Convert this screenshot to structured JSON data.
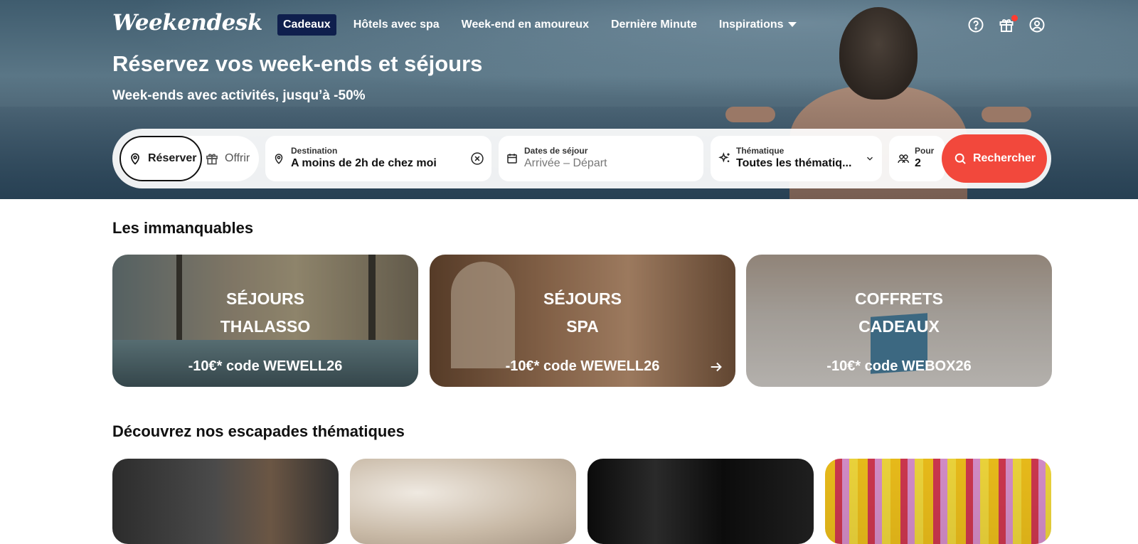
{
  "brand": {
    "logo_text": "Weekendesk"
  },
  "nav": {
    "items": [
      {
        "label": "Cadeaux",
        "active": true
      },
      {
        "label": "Hôtels avec spa"
      },
      {
        "label": "Week-end en amoureux"
      },
      {
        "label": "Dernière Minute"
      },
      {
        "label": "Inspirations"
      }
    ]
  },
  "top_icons": [
    "help-icon",
    "gift-icon",
    "account-icon"
  ],
  "hero": {
    "title": "Réservez vos week-ends et séjours",
    "subtitle": "Week-ends avec activités, jusqu’à -50%"
  },
  "search": {
    "mode_reserve": "Réserver",
    "mode_offer": "Offrir",
    "destination_label": "Destination",
    "destination_value": "A moins de 2h de chez moi",
    "dates_label": "Dates de séjour",
    "dates_placeholder": "Arrivée – Départ",
    "theme_label": "Thématique",
    "theme_value": "Toutes les thématiq...",
    "pour_label": "Pour",
    "pour_value": "2",
    "button_label": "Rechercher",
    "accent_color": "#f2483c"
  },
  "sections": {
    "immanquables_title": "Les immanquables",
    "escapades_title": "Découvrez nos escapades thématiques"
  },
  "cards": [
    {
      "line1": "SÉJOURS",
      "line2": "THALASSO",
      "promo": "-10€* code WEWELL26"
    },
    {
      "line1": "SÉJOURS",
      "line2": "SPA",
      "promo": "-10€* code WEWELL26"
    },
    {
      "line1": "COFFRETS",
      "line2": "CADEAUX",
      "promo": "-10€* code WEBOX26"
    }
  ]
}
